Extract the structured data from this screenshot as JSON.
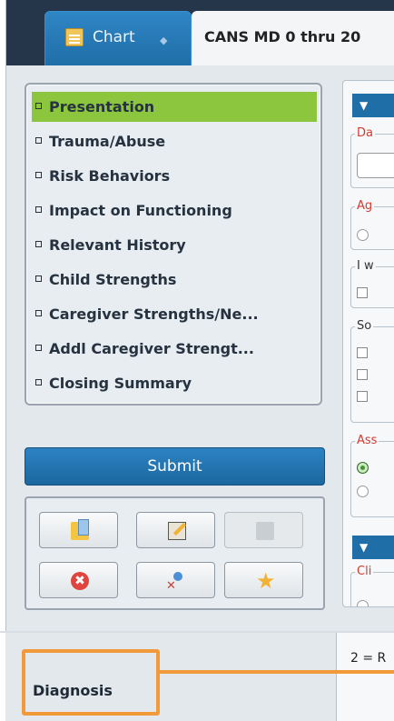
{
  "tabs": [
    {
      "label": "Chart",
      "icon": "clipboard-icon",
      "pin_icon": "pin-icon"
    },
    {
      "label": "CANS MD 0 thru 20"
    }
  ],
  "nav": {
    "items": [
      {
        "label": "Presentation",
        "active": true
      },
      {
        "label": "Trauma/Abuse"
      },
      {
        "label": "Risk Behaviors"
      },
      {
        "label": "Impact on Functioning"
      },
      {
        "label": "Relevant History"
      },
      {
        "label": "Child Strengths"
      },
      {
        "label": "Caregiver Strengths/Ne..."
      },
      {
        "label": "Addl Caregiver Strengt..."
      },
      {
        "label": "Closing Summary"
      }
    ]
  },
  "submit_label": "Submit",
  "toolbar": {
    "buttons": [
      {
        "icon": "open-document-icon"
      },
      {
        "icon": "edit-note-icon"
      },
      {
        "icon": "sticky-note-icon",
        "disabled": true
      },
      {
        "icon": "cancel-icon",
        "glyph": "✖"
      },
      {
        "icon": "remove-user-icon"
      },
      {
        "icon": "favorite-star-icon",
        "glyph": "★"
      }
    ]
  },
  "form": {
    "section1_toggle": "▼",
    "section2_toggle": "▼",
    "labels": {
      "da": "Da",
      "ag": "Ag",
      "iw": "I w",
      "so": "So",
      "as": "Ass",
      "cli": "Cli"
    }
  },
  "bottom": {
    "diagnosis_label": "Diagnosis",
    "right_text": "2 = R"
  },
  "colors": {
    "accent_blue": "#1f6ea8",
    "active_green": "#8cc63f",
    "callout_orange": "#f29a3a",
    "required_red": "#d23a30"
  }
}
